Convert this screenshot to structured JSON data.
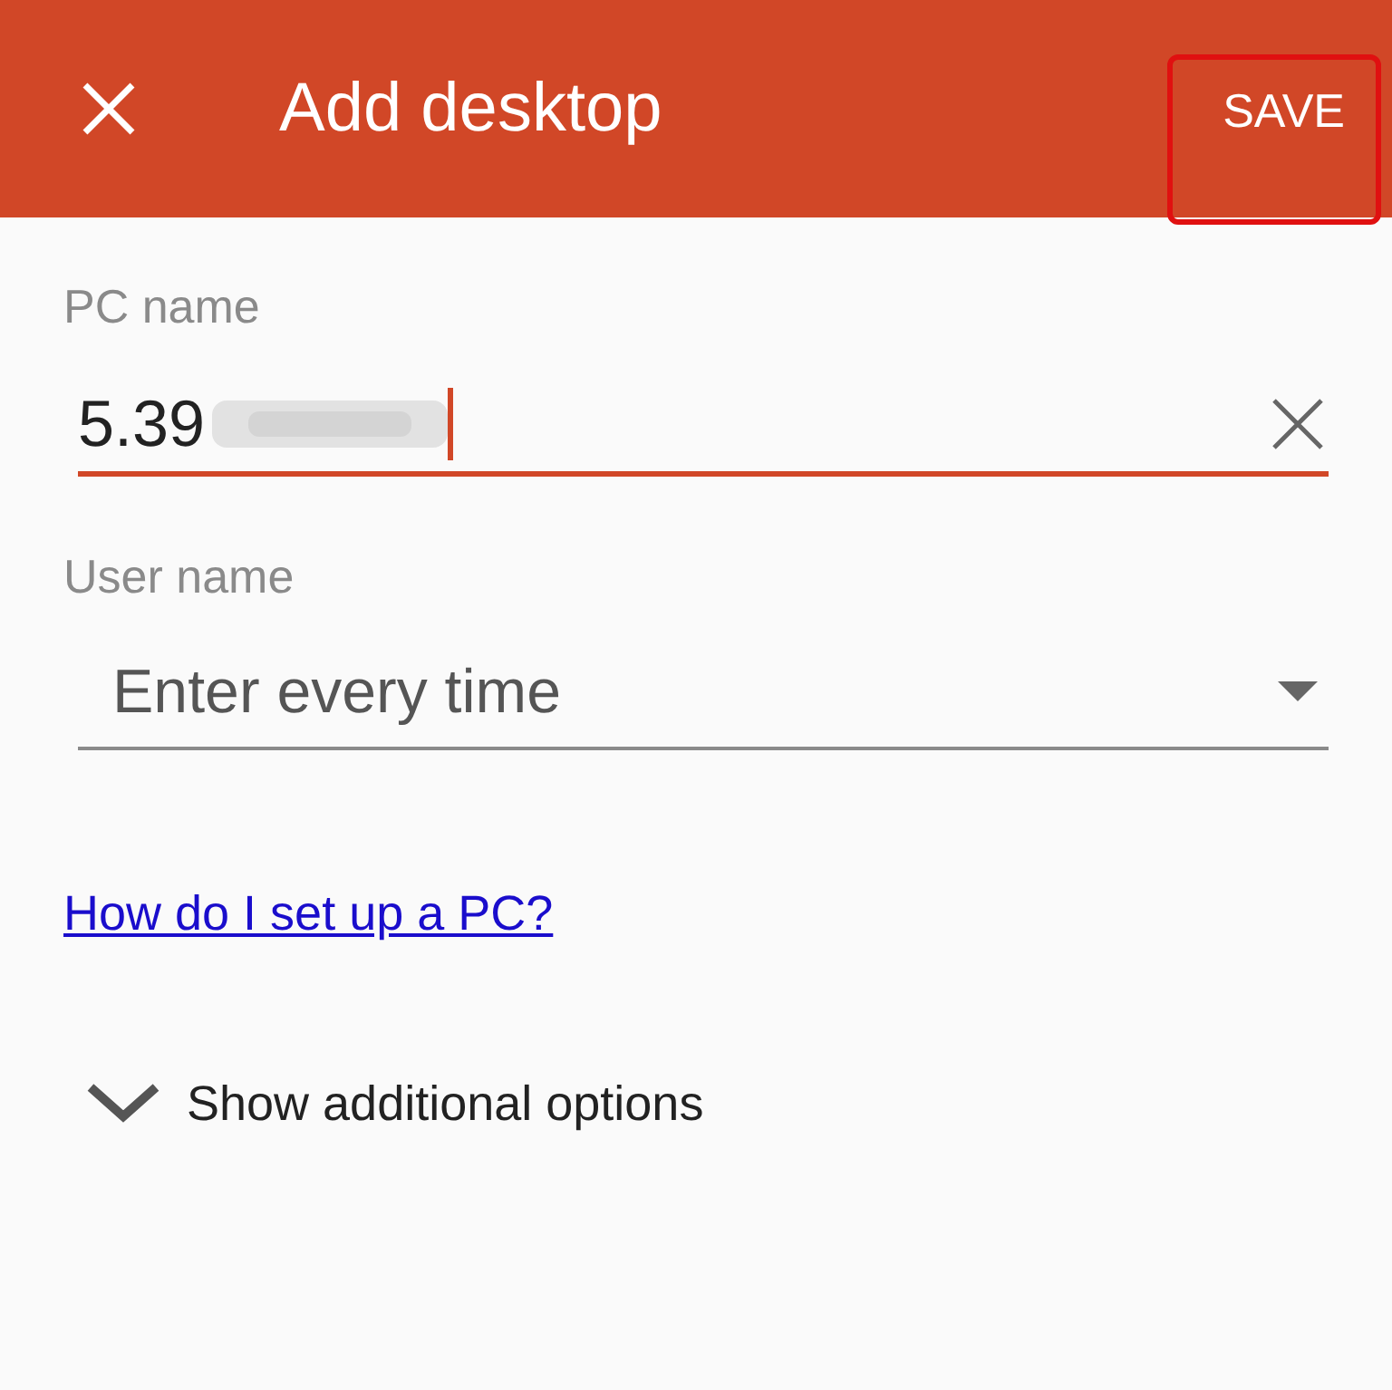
{
  "header": {
    "title": "Add desktop",
    "save": "SAVE",
    "save_highlighted": true
  },
  "pc_name": {
    "label": "PC name",
    "value": "5.39",
    "redacted": true,
    "focused": true
  },
  "user_name": {
    "label": "User name",
    "value": "Enter every time"
  },
  "help_link": "How do I set up a PC?",
  "additional_options": {
    "label": "Show additional options",
    "expanded": false
  }
}
